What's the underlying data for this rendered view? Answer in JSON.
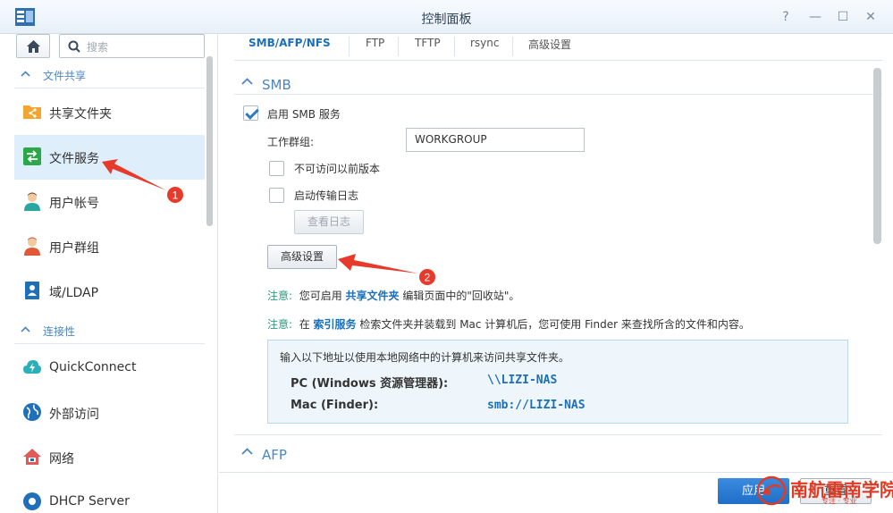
{
  "window": {
    "title": "控制面板"
  },
  "search": {
    "placeholder": "搜索"
  },
  "sidebar": {
    "sections": [
      {
        "label": "文件共享"
      },
      {
        "label": "连接性"
      }
    ],
    "items": [
      {
        "label": "共享文件夹",
        "icon": "shared-folder-icon"
      },
      {
        "label": "文件服务",
        "icon": "file-services-icon",
        "active": true
      },
      {
        "label": "用户帐号",
        "icon": "user-icon"
      },
      {
        "label": "用户群组",
        "icon": "group-icon"
      },
      {
        "label": "域/LDAP",
        "icon": "domain-icon"
      },
      {
        "label": "QuickConnect",
        "icon": "quickconnect-icon"
      },
      {
        "label": "外部访问",
        "icon": "globe-icon"
      },
      {
        "label": "网络",
        "icon": "network-house-icon"
      },
      {
        "label": "DHCP Server",
        "icon": "dhcp-icon"
      }
    ]
  },
  "tabs": [
    {
      "label": "SMB/AFP/NFS",
      "active": true
    },
    {
      "label": "FTP"
    },
    {
      "label": "TFTP"
    },
    {
      "label": "rsync"
    },
    {
      "label": "高级设置"
    }
  ],
  "smb": {
    "section_label": "SMB",
    "enable_label": "启用 SMB 服务",
    "enable_checked": true,
    "workgroup_label": "工作群组:",
    "workgroup_value": "WORKGROUP",
    "prev_versions_label": "不可访问以前版本",
    "prev_versions_checked": false,
    "transfer_log_label": "启动传输日志",
    "transfer_log_checked": false,
    "view_log_button": "查看日志",
    "advanced_button": "高级设置",
    "note1": {
      "prefix": "注意:",
      "pre": "您可启用",
      "link": "共享文件夹",
      "post": "编辑页面中的\"回收站\"。"
    },
    "note2": {
      "prefix": "注意:",
      "pre": "在",
      "link": "索引服务",
      "post": "检索文件夹并装载到 Mac 计算机后，您可使用 Finder 来查找所含的文件和内容。"
    },
    "info": {
      "intro": "输入以下地址以使用本地网络中的计算机来访问共享文件夹。",
      "rows": [
        {
          "key": "PC (Windows 资源管理器):",
          "value": "\\\\LIZI-NAS"
        },
        {
          "key": "Mac (Finder):",
          "value": "smb://LIZI-NAS"
        }
      ]
    }
  },
  "afp": {
    "section_label": "AFP"
  },
  "footer": {
    "apply_label": "应用",
    "reset_label": "重置"
  },
  "annotations": {
    "marker1": "1",
    "marker2": "2"
  },
  "watermark": {
    "text": "南航雷南学院",
    "sub": "专注 · 专业"
  },
  "colors": {
    "accent": "#1c6fb9",
    "note": "#2c9a7b",
    "annotation": "#e83a2a",
    "active_bg": "#dfeefb"
  }
}
